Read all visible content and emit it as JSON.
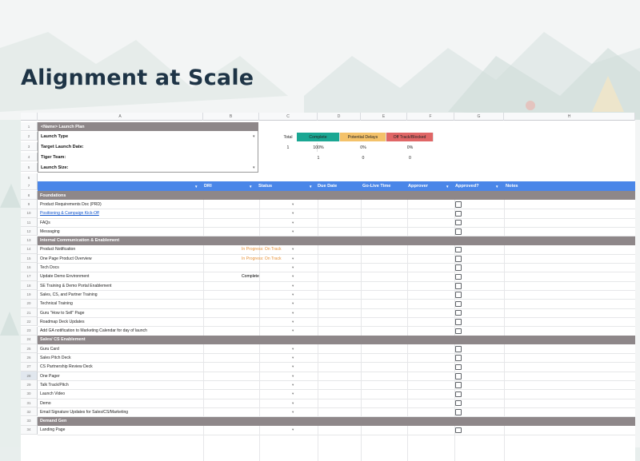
{
  "slide": {
    "title": "Alignment at Scale"
  },
  "sheet": {
    "columns": [
      "A",
      "B",
      "C",
      "D",
      "E",
      "F",
      "G",
      "H"
    ],
    "plan": {
      "header": "<Name> Launch Plan",
      "rows": [
        {
          "num": "2",
          "label": "Launch Type",
          "dropdown": true
        },
        {
          "num": "3",
          "label": "Target Launch Date:",
          "dropdown": false
        },
        {
          "num": "4",
          "label": "Tiger Team:",
          "dropdown": false
        },
        {
          "num": "5",
          "label": "Launch Size:",
          "dropdown": true
        }
      ],
      "total_label": "Total",
      "total_value": "1",
      "statuses": [
        {
          "label": "Complete",
          "color": "#1aa793",
          "pct": "100%",
          "count": "1"
        },
        {
          "label": "Potential Delays",
          "color": "#f4c26a",
          "pct": "0%",
          "count": "0"
        },
        {
          "label": "Off Track/Blocked",
          "color": "#e06666",
          "pct": "0%",
          "count": "0"
        }
      ]
    },
    "table_headers": [
      "DRI",
      "Status",
      "Due Date",
      "Go-Live Time",
      "Approver",
      "Approved?",
      "Notes"
    ],
    "row_numbers": [
      "1",
      "2",
      "3",
      "4",
      "5",
      "6",
      "7",
      "8",
      "9",
      "10",
      "11",
      "12",
      "13",
      "14",
      "15",
      "16",
      "17",
      "18",
      "19",
      "20",
      "21",
      "22",
      "23",
      "24",
      "25",
      "26",
      "27",
      "28",
      "29",
      "30",
      "31",
      "32",
      "33",
      "34"
    ],
    "sections": [
      {
        "name": "Foundations",
        "tasks": [
          {
            "name": "Product Requirements Doc (PRD)",
            "status": ""
          },
          {
            "name": "Positioning & Campaign Kick-Off",
            "status": "",
            "link": true
          },
          {
            "name": "FAQs",
            "status": ""
          },
          {
            "name": "Messaging",
            "status": ""
          }
        ]
      },
      {
        "name": "Internal Communication & Enablement",
        "tasks": [
          {
            "name": "Product Notification",
            "status": "In Progress: On Track"
          },
          {
            "name": "One Page Product Overview",
            "status": "In Progress: On Track"
          },
          {
            "name": "Tech Docs",
            "status": ""
          },
          {
            "name": "Update Demo Environment",
            "status": "Complete"
          },
          {
            "name": "SE Training & Demo Portal Enablement",
            "status": ""
          },
          {
            "name": "Sales, CS, and Partner Training",
            "status": ""
          },
          {
            "name": "Technical Training",
            "status": ""
          },
          {
            "name": "Guru \"How to Sell\" Page",
            "status": ""
          },
          {
            "name": "Roadmap Deck Updates",
            "status": ""
          },
          {
            "name": "Add GA notification to Marketing Calendar for day of launch",
            "status": ""
          }
        ]
      },
      {
        "name": "Sales/ CS Enablement",
        "tasks": [
          {
            "name": "Guru Card",
            "status": ""
          },
          {
            "name": "Sales Pitch Deck",
            "status": ""
          },
          {
            "name": "CS Partnership Review Deck",
            "status": ""
          },
          {
            "name": "One Pager",
            "status": ""
          },
          {
            "name": "Talk Track/Pitch",
            "status": ""
          },
          {
            "name": "Launch Video",
            "status": ""
          },
          {
            "name": "Demo",
            "status": ""
          },
          {
            "name": "Email Signature Updates for Sales/CS/Marketing",
            "status": ""
          }
        ]
      },
      {
        "name": "Demand Gen",
        "tasks": [
          {
            "name": "Landing Page",
            "status": ""
          }
        ]
      }
    ],
    "colors": {
      "header_bar": "#4a86e8",
      "section_bar": "#8e8789",
      "in_progress": "#e69138",
      "link": "#1155cc"
    }
  }
}
